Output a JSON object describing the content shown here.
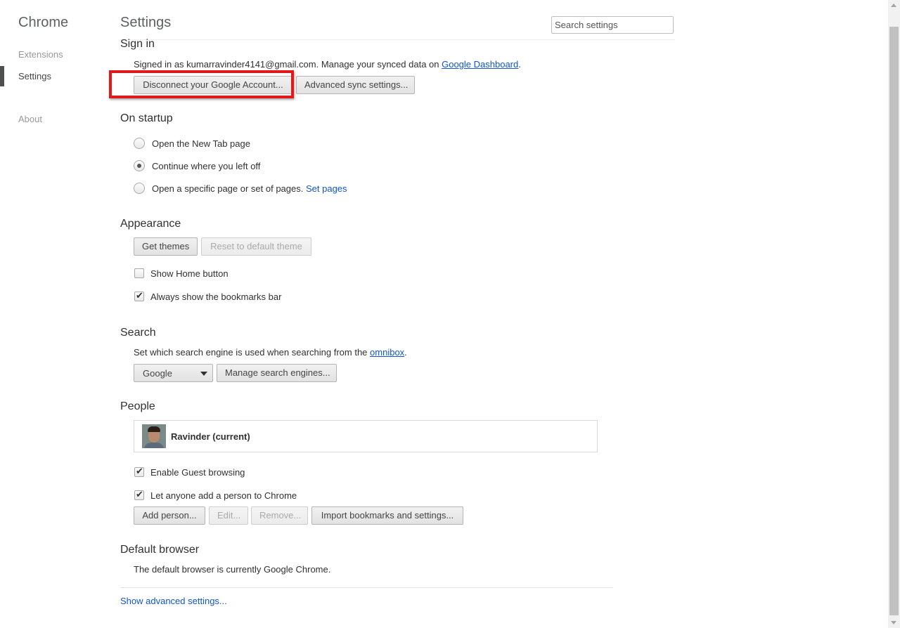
{
  "sidebar": {
    "brand": "Chrome",
    "items": [
      {
        "label": "Extensions"
      },
      {
        "label": "Settings"
      },
      {
        "label": "About"
      }
    ]
  },
  "header": {
    "title": "Settings",
    "search_placeholder": "Search settings"
  },
  "signin": {
    "title": "Sign in",
    "text_before": "Signed in as kumarravinder4141@gmail.com. Manage your synced data on ",
    "link": "Google Dashboard",
    "text_after": ".",
    "disconnect_button": "Disconnect your Google Account...",
    "advanced_sync_button": "Advanced sync settings..."
  },
  "startup": {
    "title": "On startup",
    "options": [
      {
        "label": "Open the New Tab page",
        "checked": false
      },
      {
        "label": "Continue where you left off",
        "checked": true
      },
      {
        "label": "Open a specific page or set of pages.",
        "checked": false
      }
    ],
    "set_pages_link": "Set pages"
  },
  "appearance": {
    "title": "Appearance",
    "get_themes_button": "Get themes",
    "reset_theme_button": "Reset to default theme",
    "show_home_button": {
      "label": "Show Home button",
      "checked": false
    },
    "show_bookmarks_bar": {
      "label": "Always show the bookmarks bar",
      "checked": true
    }
  },
  "search": {
    "title": "Search",
    "text_before": "Set which search engine is used when searching from the ",
    "link": "omnibox",
    "text_after": ".",
    "engine": "Google",
    "manage_button": "Manage search engines..."
  },
  "people": {
    "title": "People",
    "profile_name": "Ravinder (current)",
    "guest_browsing": {
      "label": "Enable Guest browsing",
      "checked": true
    },
    "let_anyone_add": {
      "label": "Let anyone add a person to Chrome",
      "checked": true
    },
    "add_person_button": "Add person...",
    "edit_button": "Edit...",
    "remove_button": "Remove...",
    "import_button": "Import bookmarks and settings..."
  },
  "default_browser": {
    "title": "Default browser",
    "text": "The default browser is currently Google Chrome."
  },
  "footer": {
    "show_advanced_link": "Show advanced settings..."
  },
  "colors": {
    "link": "#1155cc",
    "highlight": "#e01a1a"
  }
}
